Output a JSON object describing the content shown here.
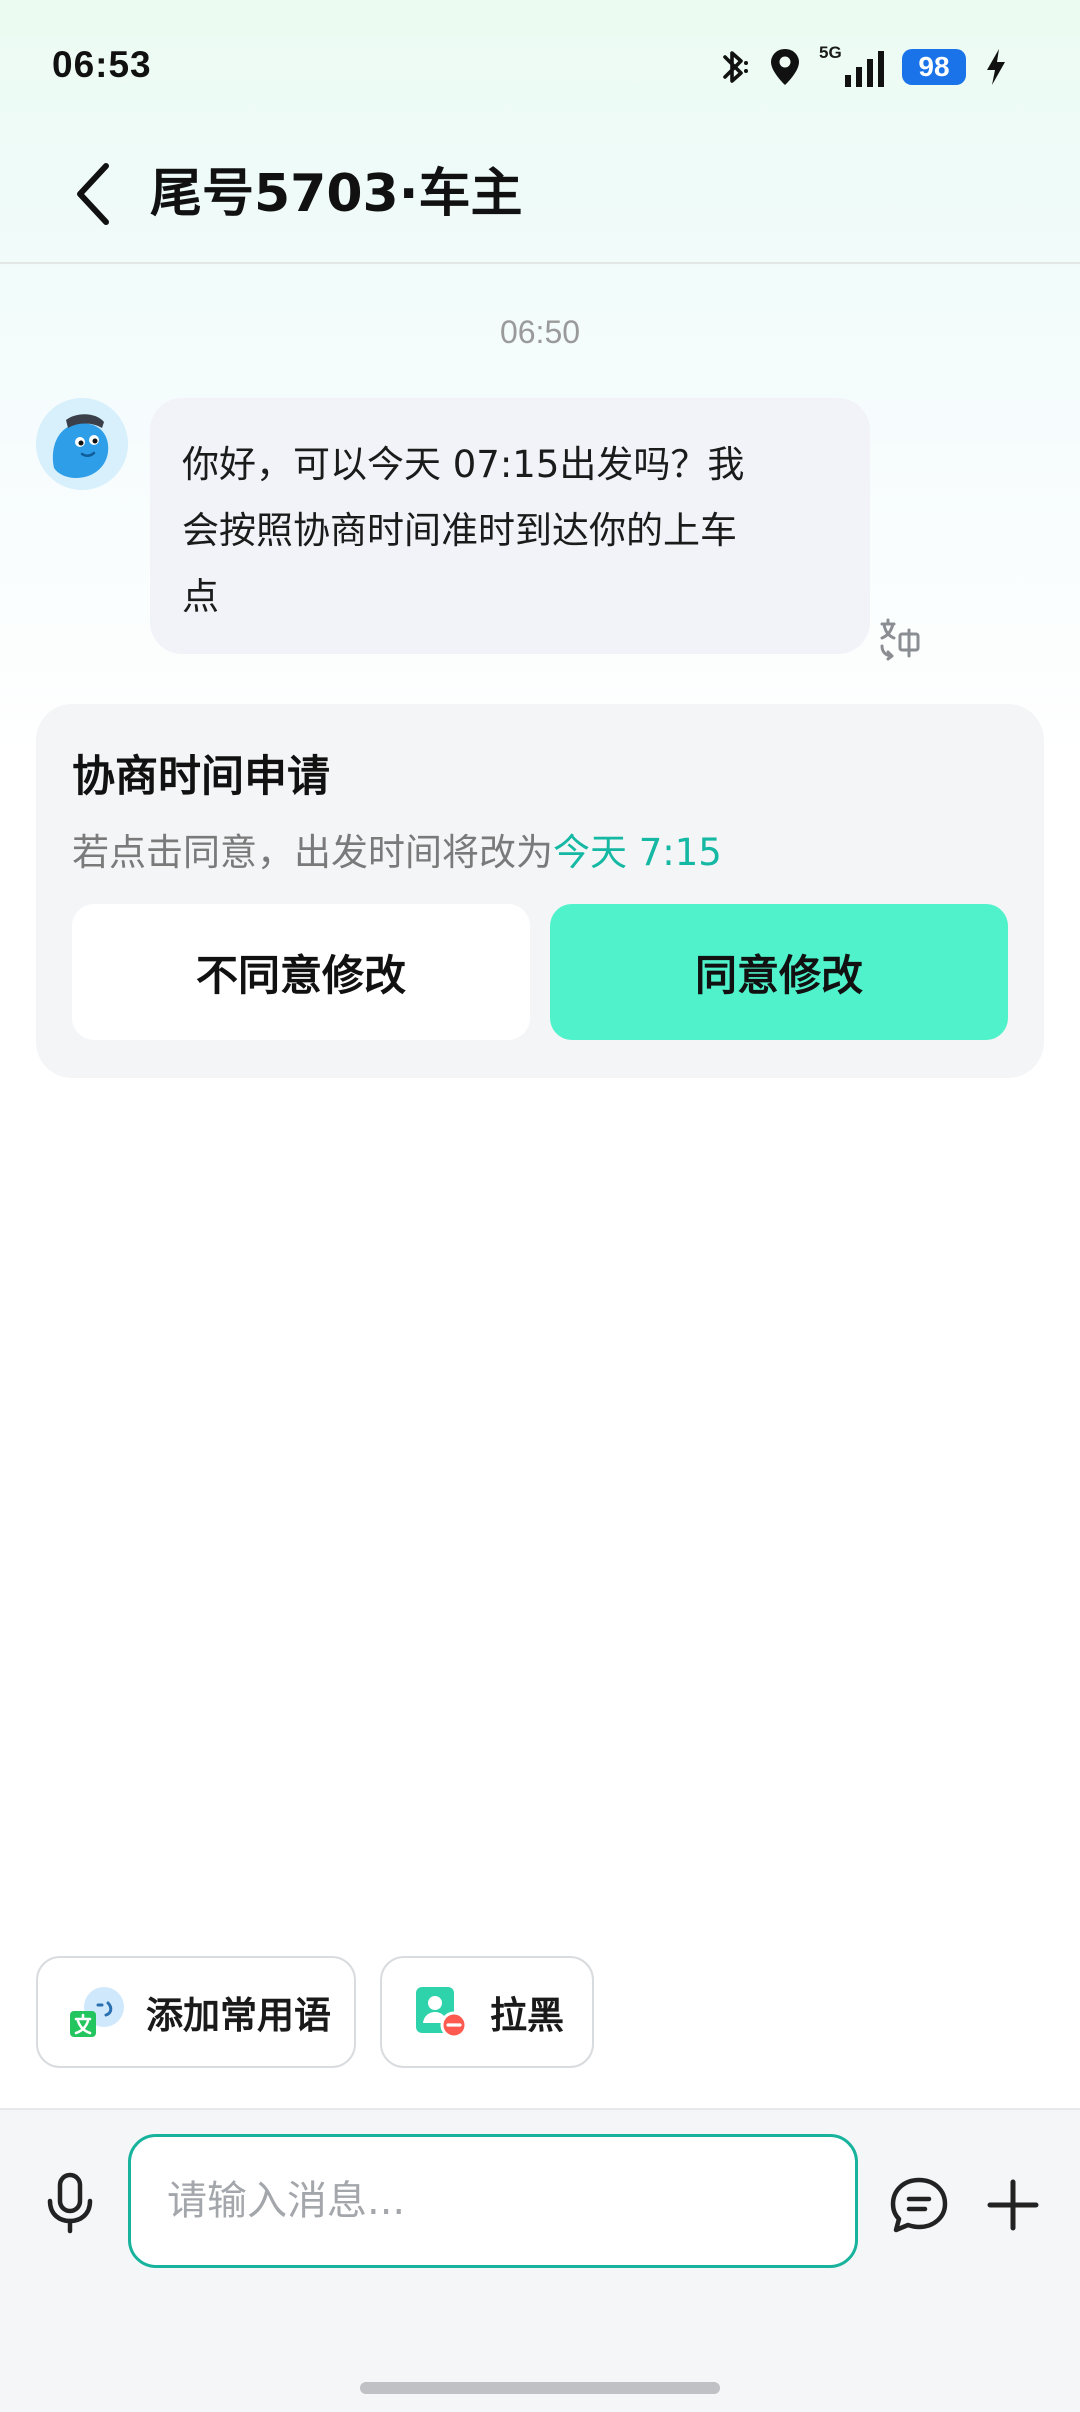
{
  "status_bar": {
    "time": "06:53",
    "network": "5G",
    "battery": "98",
    "icons": [
      "bluetooth-icon",
      "location-icon",
      "signal-icon",
      "battery-icon",
      "charging-icon"
    ]
  },
  "header": {
    "title": "尾号5703·车主",
    "back_icon": "chevron-left-icon"
  },
  "chat": {
    "timestamp": "06:50",
    "message": {
      "line1": "你好，可以今天 07:15出发吗？我",
      "line2": "会按照协商时间准时到达你的上车",
      "line3": "点",
      "translate_icon": "translate-icon"
    }
  },
  "negotiation_card": {
    "title": "协商时间申请",
    "description": "若点击同意，出发时间将改为",
    "new_time": "今天 7:15",
    "decline_label": "不同意修改",
    "accept_label": "同意修改"
  },
  "quick_actions": {
    "add_phrase_label": "添加常用语",
    "block_label": "拉黑"
  },
  "input_bar": {
    "placeholder": "请输入消息...",
    "mic_icon": "microphone-icon",
    "phrase_icon": "chat-bubble-icon",
    "plus_icon": "plus-icon"
  },
  "colors": {
    "accent": "#4ff2ca",
    "accent_text": "#14b8a3",
    "input_border": "#18b39c",
    "battery": "#1a73e8"
  }
}
